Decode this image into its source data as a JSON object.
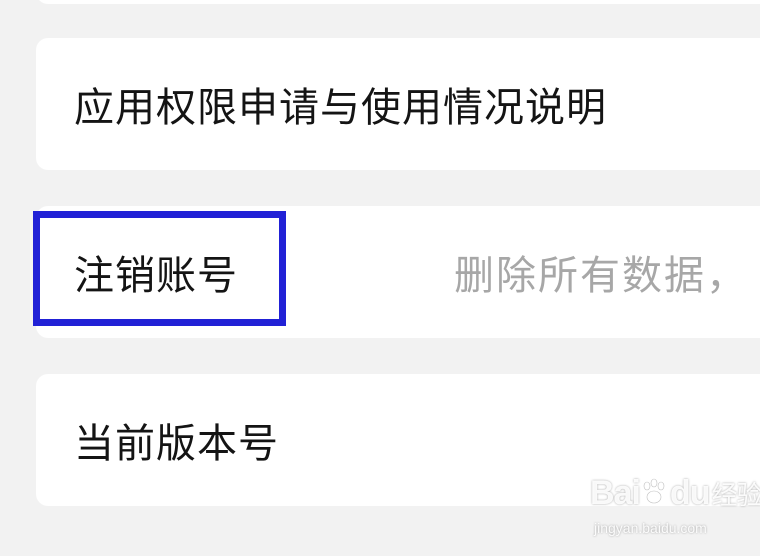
{
  "settings": {
    "items": [
      {
        "label": "应用权限申请与使用情况说明",
        "value": ""
      },
      {
        "label": "注销账号",
        "value": "删除所有数据，"
      },
      {
        "label": "当前版本号",
        "value": ""
      }
    ]
  },
  "annotation": {
    "highlight_color": "#2121d6"
  },
  "watermark": {
    "logo_left": "Bai",
    "logo_right": "du",
    "logo_suffix": "经验",
    "sub": "jingyan.baidu.com"
  }
}
